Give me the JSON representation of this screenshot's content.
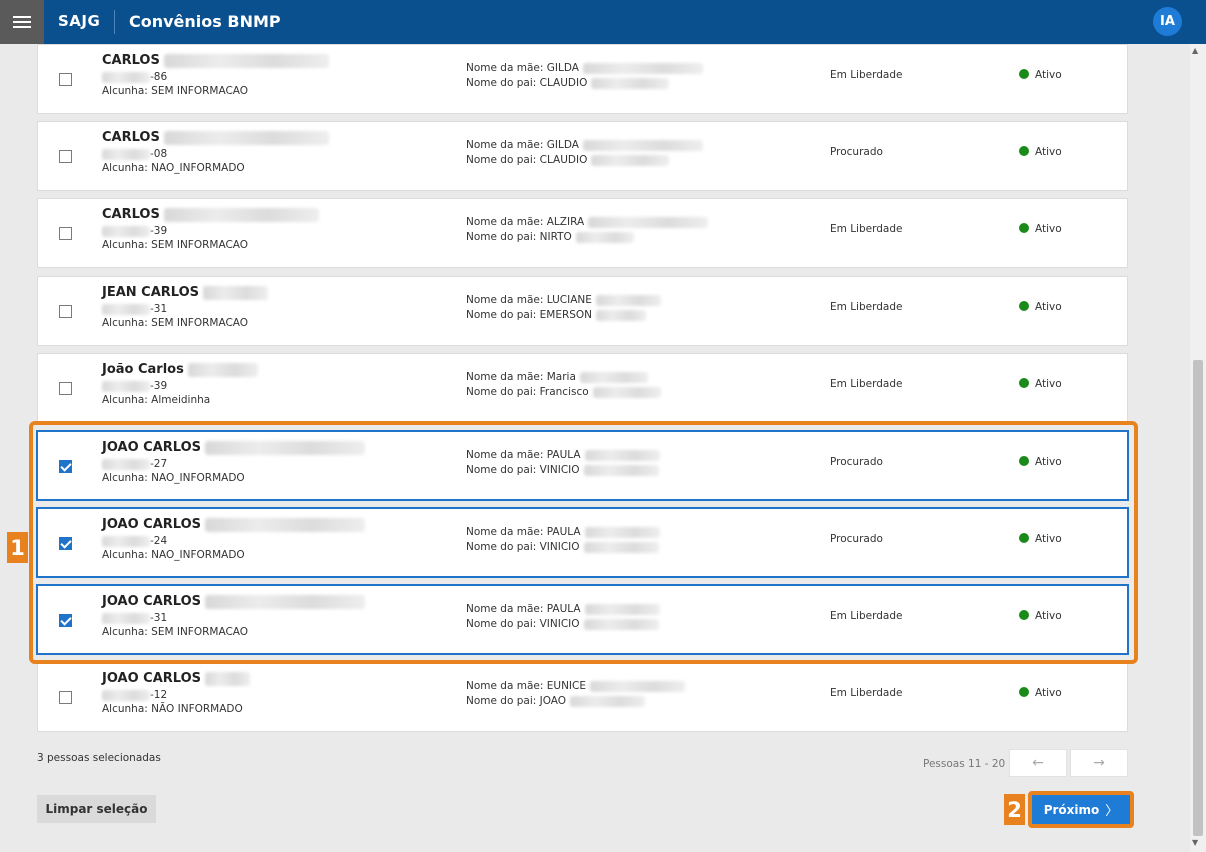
{
  "header": {
    "brand": "SAJG",
    "title": "Convênios BNMP",
    "avatar_initials": "IA"
  },
  "labels": {
    "mae_prefix": "Nome da mãe: ",
    "pai_prefix": "Nome do pai: ",
    "alcunha_prefix": "Alcunha: "
  },
  "rows": [
    {
      "name": "CARLOS",
      "doc_suffix": "-86",
      "alcunha": "SEM INFORMACAO",
      "mae": "GILDA",
      "pai": "CLAUDIO",
      "situacao": "Em Liberdade",
      "status": "Ativo",
      "checked": false
    },
    {
      "name": "CARLOS",
      "doc_suffix": "-08",
      "alcunha": "NAO_INFORMADO",
      "mae": "GILDA",
      "pai": "CLAUDIO",
      "situacao": "Procurado",
      "status": "Ativo",
      "checked": false
    },
    {
      "name": "CARLOS",
      "doc_suffix": "-39",
      "alcunha": "SEM INFORMACAO",
      "mae": "ALZIRA",
      "pai": "NIRTO",
      "situacao": "Em Liberdade",
      "status": "Ativo",
      "checked": false
    },
    {
      "name": "JEAN CARLOS",
      "doc_suffix": "-31",
      "alcunha": "SEM INFORMACAO",
      "mae": "LUCIANE",
      "pai": "EMERSON",
      "situacao": "Em Liberdade",
      "status": "Ativo",
      "checked": false
    },
    {
      "name": "João Carlos",
      "doc_suffix": "-39",
      "alcunha": "Almeidinha",
      "mae": "Maria",
      "pai": "Francisco",
      "situacao": "Em Liberdade",
      "status": "Ativo",
      "checked": false
    },
    {
      "name": "JOAO CARLOS",
      "doc_suffix": "-27",
      "alcunha": "NAO_INFORMADO",
      "mae": "PAULA",
      "pai": "VINICIO",
      "situacao": "Procurado",
      "status": "Ativo",
      "checked": true
    },
    {
      "name": "JOAO CARLOS",
      "doc_suffix": "-24",
      "alcunha": "NAO_INFORMADO",
      "mae": "PAULA",
      "pai": "VINICIO",
      "situacao": "Procurado",
      "status": "Ativo",
      "checked": true
    },
    {
      "name": "JOAO CARLOS",
      "doc_suffix": "-31",
      "alcunha": "SEM INFORMACAO",
      "mae": "PAULA",
      "pai": "VINICIO",
      "situacao": "Em Liberdade",
      "status": "Ativo",
      "checked": true
    },
    {
      "name": "JOAO CARLOS",
      "doc_suffix": "-12",
      "alcunha": "NÃO INFORMADO",
      "mae": "EUNICE",
      "pai": "JOAO",
      "situacao": "Em Liberdade",
      "status": "Ativo",
      "checked": false
    }
  ],
  "footer": {
    "selected_count": "3 pessoas selecionadas",
    "pager_label": "Pessoas 11 - 20",
    "prev_arrow": "←",
    "next_arrow": "→",
    "clear_label": "Limpar seleção",
    "next_label": "Próximo",
    "next_chevron": "〉"
  },
  "markers": {
    "one": "1",
    "two": "2"
  },
  "colors": {
    "header": "#0a4f8e",
    "accent": "#1e7bd6",
    "highlight": "#e8821e",
    "active": "#1a8a1a"
  }
}
